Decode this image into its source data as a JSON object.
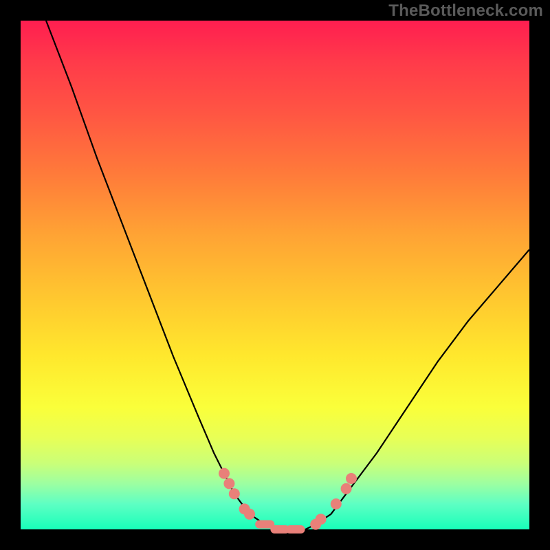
{
  "watermark": "TheBottleneck.com",
  "colors": {
    "frame_bg": "#000000",
    "gradient_top": "#ff1e50",
    "gradient_bottom": "#18ffb9",
    "curve_stroke": "#000000",
    "marker_fill": "#e98079",
    "watermark_text": "#5a5a5a"
  },
  "chart_data": {
    "type": "line",
    "title": "",
    "xlabel": "",
    "ylabel": "",
    "xlim": [
      0,
      100
    ],
    "ylim": [
      0,
      100
    ],
    "series": [
      {
        "name": "curve",
        "x": [
          5,
          10,
          15,
          20,
          25,
          30,
          35,
          38,
          40,
          42,
          45,
          48,
          50,
          53,
          56,
          58,
          61,
          64,
          70,
          76,
          82,
          88,
          94,
          100
        ],
        "y": [
          100,
          87,
          73,
          60,
          47,
          34,
          22,
          15,
          11,
          7,
          3,
          1,
          0,
          0,
          0,
          1,
          3,
          7,
          15,
          24,
          33,
          41,
          48,
          55
        ]
      }
    ],
    "markers": [
      {
        "x": 40,
        "y": 11,
        "shape": "circle"
      },
      {
        "x": 41,
        "y": 9,
        "shape": "circle"
      },
      {
        "x": 42,
        "y": 7,
        "shape": "circle"
      },
      {
        "x": 44,
        "y": 4,
        "shape": "circle"
      },
      {
        "x": 45,
        "y": 3,
        "shape": "circle"
      },
      {
        "x": 48,
        "y": 1,
        "shape": "pill"
      },
      {
        "x": 51,
        "y": 0,
        "shape": "pill"
      },
      {
        "x": 54,
        "y": 0,
        "shape": "pill"
      },
      {
        "x": 58,
        "y": 1,
        "shape": "circle"
      },
      {
        "x": 59,
        "y": 2,
        "shape": "circle"
      },
      {
        "x": 62,
        "y": 5,
        "shape": "circle"
      },
      {
        "x": 64,
        "y": 8,
        "shape": "circle"
      },
      {
        "x": 65,
        "y": 10,
        "shape": "circle"
      }
    ],
    "grid": false,
    "legend": false
  }
}
